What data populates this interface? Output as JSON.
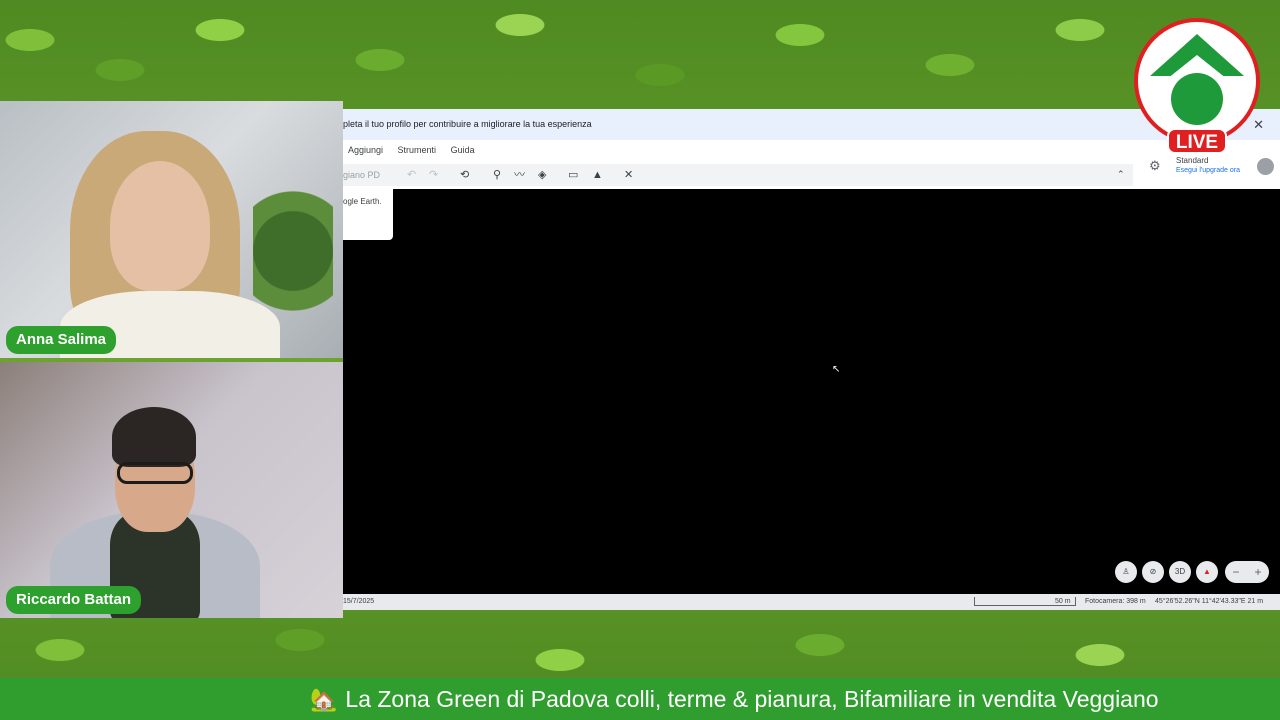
{
  "participants": [
    {
      "name": "Anna Salima"
    },
    {
      "name": "Riccardo Battan"
    }
  ],
  "screen_share": {
    "banner_text": "pleta il tuo profilo per contribuire a migliorare la tua esperienza",
    "menu": [
      "Aggiungi",
      "Strumenti",
      "Guida"
    ],
    "search_value": "giano PD",
    "popup_text": "ogle Earth.",
    "account": {
      "plan": "Standard",
      "upgrade": "Esegui l'upgrade ora"
    },
    "map_controls": {
      "3d_label": "3D"
    },
    "status": {
      "date": "15/7/2025",
      "scale": "50 m",
      "camera": "Fotocamera: 398 m",
      "coords": "45°26'52.26\"N 11°42'43.33\"E  21 m"
    }
  },
  "logo": {
    "live_label": "LIVE",
    "colors": {
      "green": "#1f9a3a",
      "red": "#e02020"
    }
  },
  "ticker": {
    "text": "La Zona Green di Padova colli, terme & pianura, Bifamiliare in vendita Veggiano"
  },
  "icons": [
    "house-icon",
    "close-icon",
    "undo-icon",
    "redo-icon",
    "history-icon",
    "placemark-icon",
    "path-icon",
    "layers-icon",
    "ruler-icon",
    "image-icon",
    "satellite-icon",
    "chevron-up-icon",
    "gear-icon",
    "pegman-icon",
    "compass-icon"
  ]
}
